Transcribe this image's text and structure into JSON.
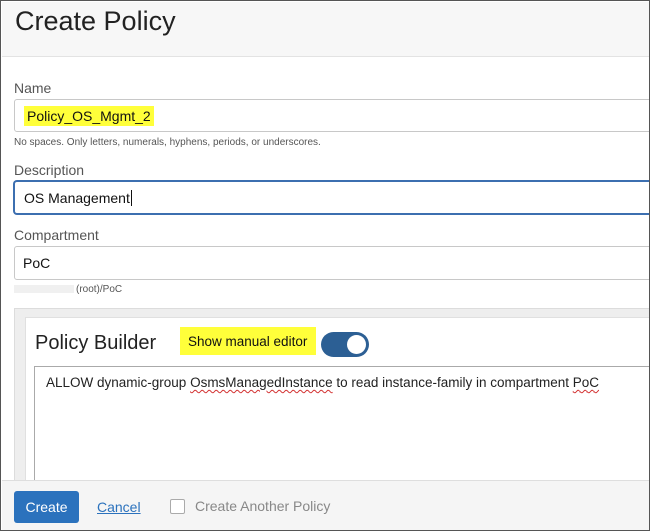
{
  "page": {
    "title": "Create Policy"
  },
  "name_field": {
    "label": "Name",
    "value": "Policy_OS_Mgmt_2",
    "hint": "No spaces. Only letters, numerals, hyphens, periods, or underscores."
  },
  "description_field": {
    "label": "Description",
    "value": "OS Management"
  },
  "compartment_field": {
    "label": "Compartment",
    "value": "PoC",
    "path": "(root)/PoC"
  },
  "policy_builder": {
    "title": "Policy Builder",
    "manual_editor_label": "Show manual editor",
    "manual_editor_enabled": true,
    "statement_part1": "ALLOW dynamic-group ",
    "statement_group": "OsmsManagedInstance",
    "statement_part2": " to read instance-family in compartment ",
    "statement_compartment": "PoC"
  },
  "footer": {
    "create_label": "Create",
    "cancel_label": "Cancel",
    "create_another_label": "Create Another Policy",
    "create_another_checked": false
  },
  "colors": {
    "primary": "#2b72bd",
    "toggle_on": "#2c5f94",
    "highlight": "#ffff3a"
  }
}
